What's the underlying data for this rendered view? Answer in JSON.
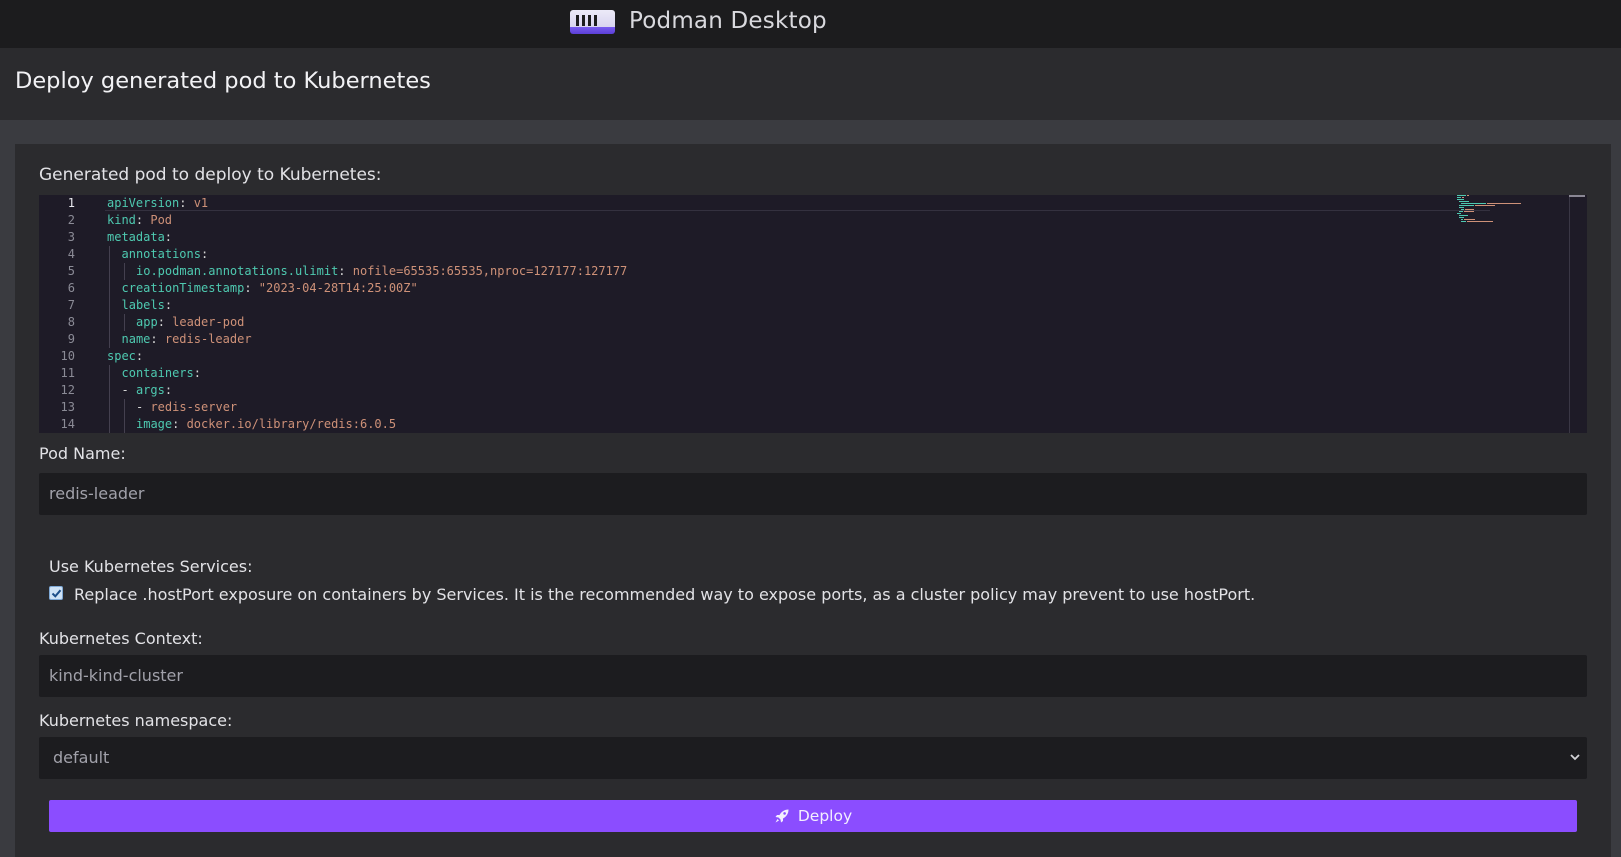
{
  "app": {
    "title": "Podman Desktop"
  },
  "page": {
    "title": "Deploy generated pod to Kubernetes"
  },
  "editor": {
    "label": "Generated pod to deploy to Kubernetes:",
    "lines": [
      {
        "n": "1",
        "indent": 0,
        "key": "apiVersion",
        "sep": ": ",
        "val": "v1"
      },
      {
        "n": "2",
        "indent": 0,
        "key": "kind",
        "sep": ": ",
        "val": "Pod"
      },
      {
        "n": "3",
        "indent": 0,
        "key": "metadata",
        "sep": ":",
        "val": ""
      },
      {
        "n": "4",
        "indent": 1,
        "key": "annotations",
        "sep": ":",
        "val": ""
      },
      {
        "n": "5",
        "indent": 2,
        "key": "io.podman.annotations.ulimit",
        "sep": ": ",
        "val": "nofile=65535:65535,nproc=127177:127177"
      },
      {
        "n": "6",
        "indent": 1,
        "key": "creationTimestamp",
        "sep": ": ",
        "val": "\"2023-04-28T14:25:00Z\""
      },
      {
        "n": "7",
        "indent": 1,
        "key": "labels",
        "sep": ":",
        "val": ""
      },
      {
        "n": "8",
        "indent": 2,
        "key": "app",
        "sep": ": ",
        "val": "leader-pod"
      },
      {
        "n": "9",
        "indent": 1,
        "key": "name",
        "sep": ": ",
        "val": "redis-leader"
      },
      {
        "n": "10",
        "indent": 0,
        "key": "spec",
        "sep": ":",
        "val": ""
      },
      {
        "n": "11",
        "indent": 1,
        "key": "containers",
        "sep": ":",
        "val": ""
      },
      {
        "n": "12",
        "indent": 1,
        "key": "- args",
        "sep": ":",
        "val": ""
      },
      {
        "n": "13",
        "indent": 2,
        "key": "",
        "sep": "- ",
        "val": "redis-server"
      },
      {
        "n": "14",
        "indent": 2,
        "key": "image",
        "sep": ": ",
        "val": "docker.io/library/redis:6.0.5"
      }
    ]
  },
  "pod_name": {
    "label": "Pod Name:",
    "value": "redis-leader"
  },
  "services": {
    "label": "Use Kubernetes Services:",
    "checkbox_label": "Replace .hostPort exposure on containers by Services. It is the recommended way to expose ports, as a cluster policy may prevent to use hostPort.",
    "checked": true
  },
  "context": {
    "label": "Kubernetes Context:",
    "value": "kind-kind-cluster"
  },
  "namespace": {
    "label": "Kubernetes namespace:",
    "selected": "default"
  },
  "deploy": {
    "label": "Deploy"
  },
  "colors": {
    "accent": "#8b4dff",
    "yaml_key": "#4ec9b0",
    "yaml_value": "#ce9178"
  }
}
